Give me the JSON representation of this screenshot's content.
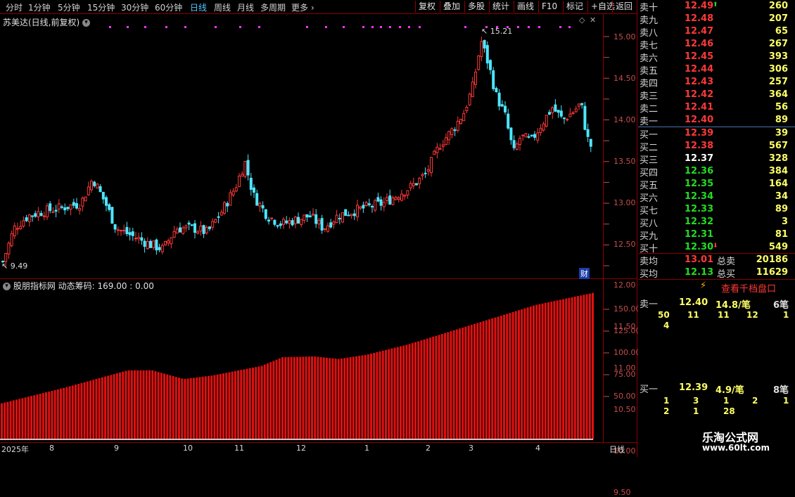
{
  "toolbar": {
    "periods": [
      "分时",
      "1分钟",
      "5分钟",
      "15分钟",
      "30分钟",
      "60分钟",
      "日线",
      "周线",
      "月线",
      "多周期",
      "更多"
    ],
    "active_period": "日线",
    "buttons": [
      "复权",
      "叠加",
      "多股",
      "统计",
      "画线",
      "F10",
      "标记",
      "+自选",
      "返回"
    ]
  },
  "stock": {
    "title": "苏美达(日线,前复权)",
    "high_label": "15.21",
    "low_label": "9.49",
    "cai_badge": "财",
    "price_axis": [
      "15.00",
      "14.50",
      "14.00",
      "13.50",
      "13.00",
      "12.50",
      "12.00",
      "11.50",
      "11.00",
      "10.50",
      "10.00",
      "9.50"
    ]
  },
  "indicator": {
    "title": "股朋指标网  动态筹码: 169.00 : 0.00",
    "axis": [
      "150.00",
      "125.00",
      "100.00",
      "75.00",
      "50.00"
    ]
  },
  "time_axis": {
    "labels": [
      "2025年",
      "8",
      "9",
      "10",
      "11",
      "12",
      "1",
      "2",
      "3",
      "4"
    ],
    "period_label": "日线"
  },
  "orderbook": {
    "sell": [
      {
        "name": "卖十",
        "price": "12.49",
        "vol": "260"
      },
      {
        "name": "卖九",
        "price": "12.48",
        "vol": "207"
      },
      {
        "name": "卖八",
        "price": "12.47",
        "vol": "65"
      },
      {
        "name": "卖七",
        "price": "12.46",
        "vol": "267"
      },
      {
        "name": "卖六",
        "price": "12.45",
        "vol": "393"
      },
      {
        "name": "卖五",
        "price": "12.44",
        "vol": "306"
      },
      {
        "name": "卖四",
        "price": "12.43",
        "vol": "257"
      },
      {
        "name": "卖三",
        "price": "12.42",
        "vol": "364"
      },
      {
        "name": "卖二",
        "price": "12.41",
        "vol": "56"
      },
      {
        "name": "卖一",
        "price": "12.40",
        "vol": "89"
      }
    ],
    "buy": [
      {
        "name": "买一",
        "price": "12.39",
        "vol": "39"
      },
      {
        "name": "买二",
        "price": "12.38",
        "vol": "567"
      },
      {
        "name": "买三",
        "price": "12.37",
        "vol": "328"
      },
      {
        "name": "买四",
        "price": "12.36",
        "vol": "384"
      },
      {
        "name": "买五",
        "price": "12.35",
        "vol": "164"
      },
      {
        "name": "买六",
        "price": "12.34",
        "vol": "34"
      },
      {
        "name": "买七",
        "price": "12.33",
        "vol": "89"
      },
      {
        "name": "买八",
        "price": "12.32",
        "vol": "3"
      },
      {
        "name": "买九",
        "price": "12.31",
        "vol": "81"
      },
      {
        "name": "买十",
        "price": "12.30",
        "vol": "549"
      }
    ],
    "avg_sell": {
      "name": "卖均",
      "price": "13.01",
      "total_label": "总卖",
      "total": "20186"
    },
    "avg_buy": {
      "name": "买均",
      "price": "12.13",
      "total_label": "总买",
      "total": "11629"
    }
  },
  "queue": {
    "button": "查看千档盘口",
    "sell1": {
      "name": "卖一",
      "price": "12.40",
      "per": "14.8/笔",
      "count": "6笔",
      "row1": [
        "50",
        "11",
        "11",
        "12",
        "1"
      ],
      "row2": [
        "4"
      ]
    },
    "buy1": {
      "name": "买一",
      "price": "12.39",
      "per": "4.9/笔",
      "count": "8笔",
      "row1": [
        "1",
        "3",
        "1",
        "2",
        "1"
      ],
      "row2": [
        "2",
        "1",
        "28"
      ]
    }
  },
  "logo": {
    "name": "乐淘公式网",
    "url": "www.60lt.com"
  },
  "colors": {
    "up": "#ff3838",
    "down": "#4de6ff",
    "bar": "#e01010",
    "accent": "#8b0000"
  }
}
